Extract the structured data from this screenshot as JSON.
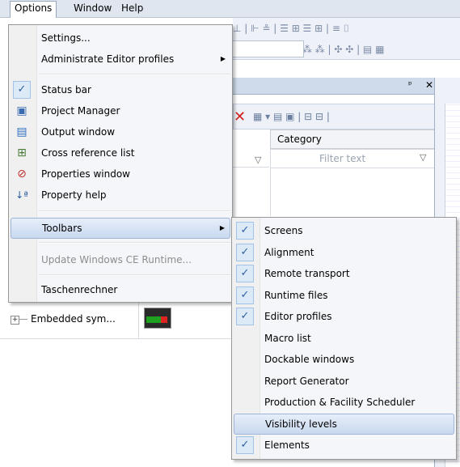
{
  "menubar": {
    "options": "Options",
    "window": "Window",
    "help": "Help"
  },
  "options_menu": {
    "settings": "Settings...",
    "editor_profiles": "Administrate Editor profiles",
    "status_bar": "Status bar",
    "project_manager": "Project Manager",
    "output_window": "Output window",
    "cross_reference": "Cross reference list",
    "properties_window": "Properties window",
    "property_help": "Property help",
    "toolbars": "Toolbars",
    "update_ce": "Update Windows CE Runtime...",
    "taschenrechner": "Taschenrechner"
  },
  "toolbars_menu": {
    "items": [
      {
        "label": "Screens",
        "checked": true
      },
      {
        "label": "Alignment",
        "checked": true
      },
      {
        "label": "Remote transport",
        "checked": true
      },
      {
        "label": "Runtime files",
        "checked": true
      },
      {
        "label": "Editor profiles",
        "checked": true
      },
      {
        "label": "Macro list",
        "checked": false
      },
      {
        "label": "Dockable windows",
        "checked": false
      },
      {
        "label": "Report Generator",
        "checked": false
      },
      {
        "label": "Production & Facility Scheduler",
        "checked": false
      },
      {
        "label": "Visibility levels",
        "checked": false
      },
      {
        "label": "Elements",
        "checked": true
      }
    ]
  },
  "background": {
    "grid_header": "Category",
    "filter_placeholder": "Filter text",
    "tree_item": "Embedded sym...",
    "panel_pin": "ᵖ",
    "panel_close": "✕"
  }
}
